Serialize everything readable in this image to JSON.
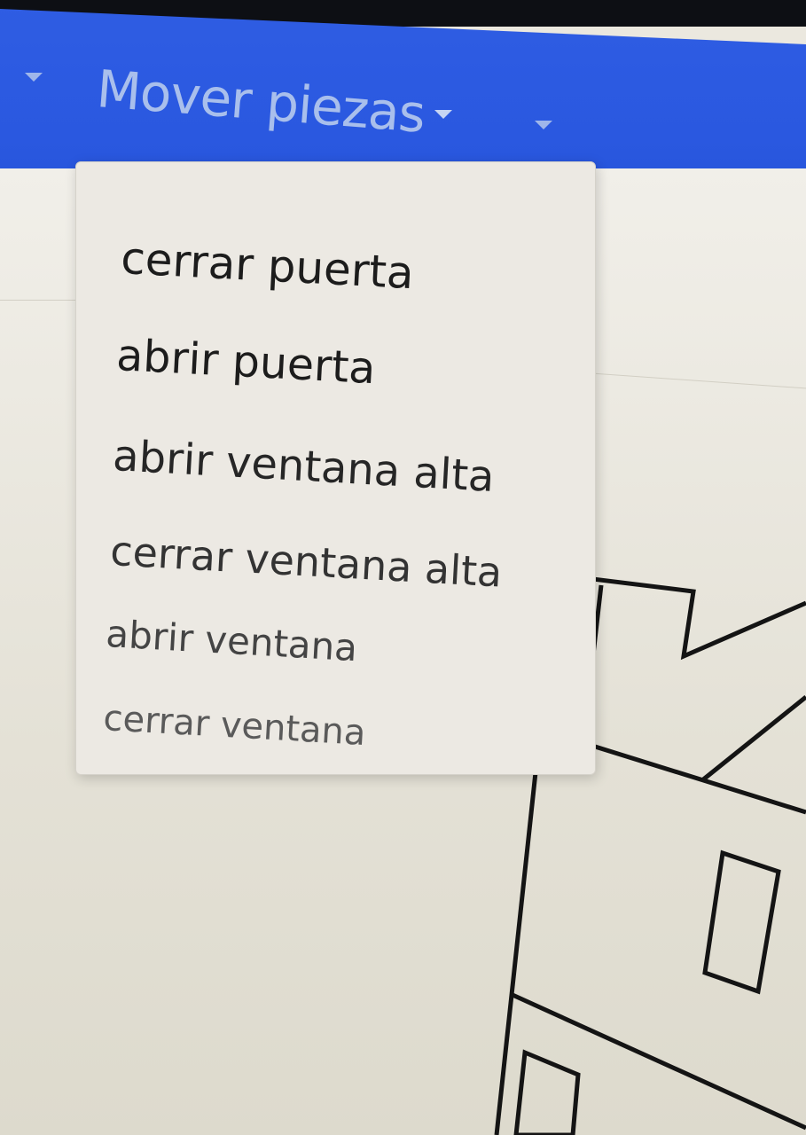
{
  "menu": {
    "title": "Mover piezas",
    "icons": [
      "dropdown-arrow-icon",
      "dropdown-arrow-icon",
      "dropdown-arrow-icon"
    ],
    "accent_color": "#2f5de3",
    "items": [
      "cerrar puerta",
      "abrir puerta",
      "abrir ventana alta",
      "cerrar ventana alta",
      "abrir ventana",
      "cerrar ventana"
    ]
  }
}
